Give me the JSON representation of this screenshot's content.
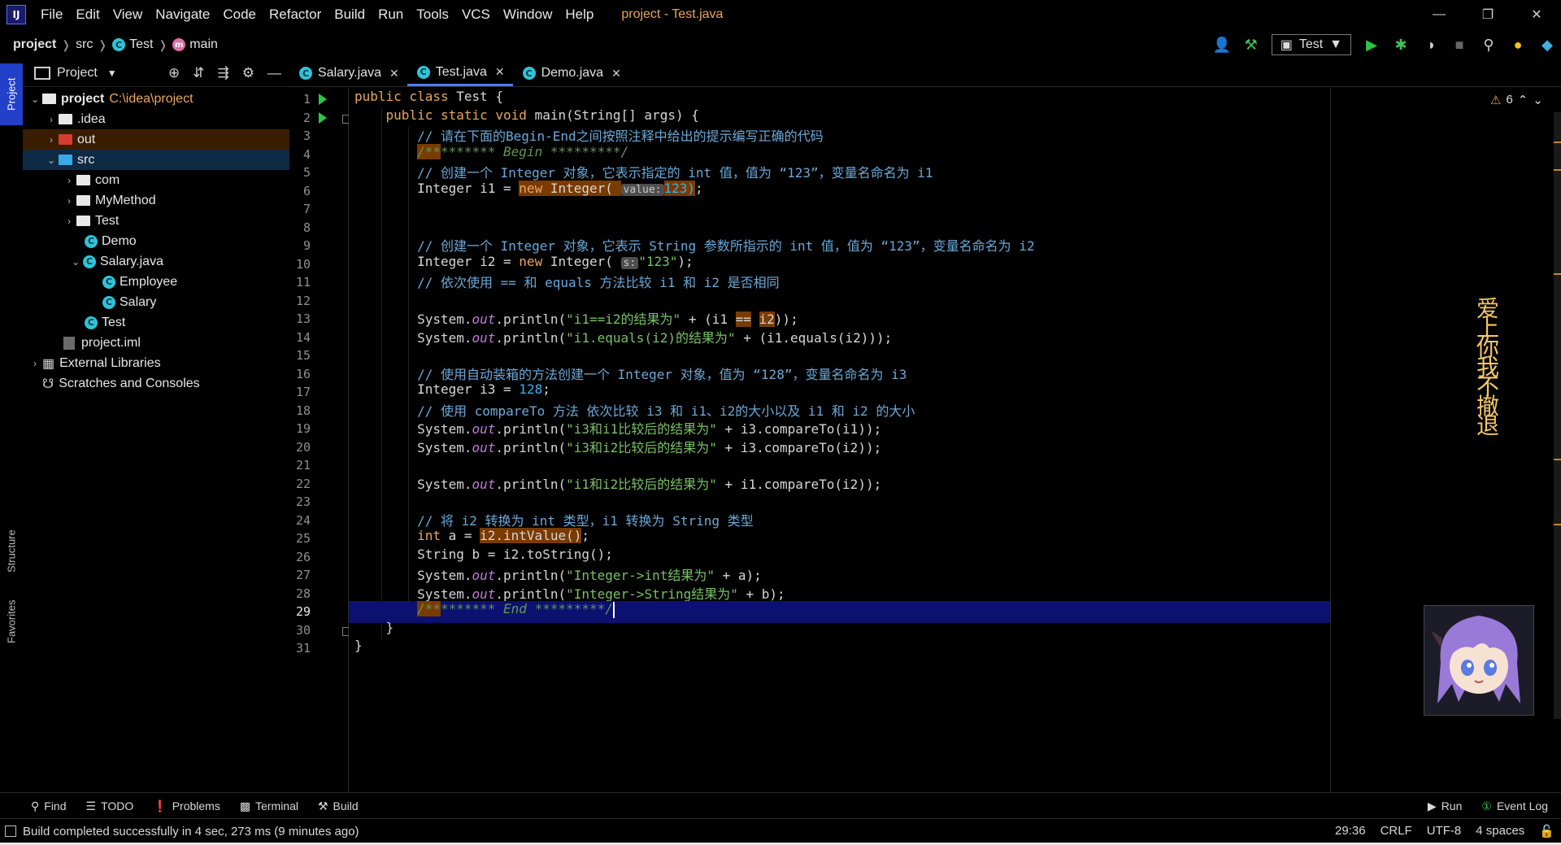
{
  "menubar": {
    "items": [
      "File",
      "Edit",
      "View",
      "Navigate",
      "Code",
      "Refactor",
      "Build",
      "Run",
      "Tools",
      "VCS",
      "Window",
      "Help"
    ],
    "title": "project - Test.java"
  },
  "breadcrumb": [
    "project",
    "src",
    "Test",
    "main"
  ],
  "run_config": "Test",
  "tool_windows": {
    "project": "Project",
    "structure": "Structure",
    "favorites": "Favorites"
  },
  "project_panel": {
    "title": "Project",
    "root": {
      "name": "project",
      "path": "C:\\idea\\project"
    },
    "items": [
      {
        "label": ".idea"
      },
      {
        "label": "out"
      },
      {
        "label": "src"
      },
      {
        "label": "com"
      },
      {
        "label": "MyMethod"
      },
      {
        "label": "Test"
      },
      {
        "label": "Demo"
      },
      {
        "label": "Salary.java"
      },
      {
        "label": "Employee"
      },
      {
        "label": "Salary"
      },
      {
        "label": "Test"
      },
      {
        "label": "project.iml"
      },
      {
        "label": "External Libraries"
      },
      {
        "label": "Scratches and Consoles"
      }
    ]
  },
  "tabs": [
    {
      "label": "Salary.java",
      "active": false
    },
    {
      "label": "Test.java",
      "active": true
    },
    {
      "label": "Demo.java",
      "active": false
    }
  ],
  "editor": {
    "warning_count": "6",
    "current_line": 29,
    "line_numbers": [
      "1",
      "2",
      "3",
      "4",
      "5",
      "6",
      "7",
      "8",
      "9",
      "10",
      "11",
      "12",
      "13",
      "14",
      "15",
      "16",
      "17",
      "18",
      "19",
      "20",
      "21",
      "22",
      "23",
      "24",
      "25",
      "26",
      "27",
      "28",
      "29",
      "30",
      "31"
    ],
    "code": [
      [
        [
          "kw",
          "public class "
        ],
        [
          "",
          "Test {"
        ]
      ],
      [
        [
          "",
          "    "
        ],
        [
          "kw",
          "public static void "
        ],
        [
          "",
          "main(String[] args) {"
        ]
      ],
      [
        [
          "",
          "        "
        ],
        [
          "cm",
          "// 请在下面的Begin-End之间按照注释中给出的提示编写正确的代码"
        ]
      ],
      [
        [
          "",
          "        "
        ],
        [
          "hl doc",
          "/**"
        ],
        [
          "doc",
          "******* Begin *********/"
        ]
      ],
      [
        [
          "",
          "        "
        ],
        [
          "cm",
          "// 创建一个 Integer 对象，它表示指定的 int 值，值为 “123”，变量名命名为 i1"
        ]
      ],
      [
        [
          "",
          "        Integer i1 = "
        ],
        [
          "hl kw",
          "new "
        ],
        [
          "hl",
          "Integer( "
        ],
        [
          "hint",
          "value:"
        ],
        [
          "hl nm2",
          "123)"
        ],
        [
          "",
          ";"
        ]
      ],
      [
        [
          "",
          ""
        ]
      ],
      [
        [
          "",
          ""
        ]
      ],
      [
        [
          "",
          "        "
        ],
        [
          "cm",
          "// 创建一个 Integer 对象，它表示 String 参数所指示的 int 值，值为 “123”，变量名命名为 i2"
        ]
      ],
      [
        [
          "",
          "        Integer i2 = "
        ],
        [
          "kw",
          "new "
        ],
        [
          "",
          "Integer( "
        ],
        [
          "hint",
          "s:"
        ],
        [
          "st",
          "\"123\""
        ],
        [
          "",
          ");"
        ]
      ],
      [
        [
          "",
          "        "
        ],
        [
          "cm",
          "// 依次使用 == 和 equals 方法比较 i1 和 i2 是否相同"
        ]
      ],
      [
        [
          "",
          ""
        ]
      ],
      [
        [
          "",
          "        System."
        ],
        [
          "fd",
          "out"
        ],
        [
          "",
          ".println("
        ],
        [
          "st",
          "\"i1==i2的结果为\""
        ],
        [
          "",
          " + (i1 "
        ],
        [
          "hl",
          "=="
        ],
        [
          "",
          " "
        ],
        [
          "hl",
          "i2"
        ],
        [
          "",
          "));"
        ]
      ],
      [
        [
          "",
          "        System."
        ],
        [
          "fd",
          "out"
        ],
        [
          "",
          ".println("
        ],
        [
          "st",
          "\"i1.equals(i2)的结果为\""
        ],
        [
          "",
          " + (i1.equals(i2)));"
        ]
      ],
      [
        [
          "",
          ""
        ]
      ],
      [
        [
          "",
          "        "
        ],
        [
          "cm",
          "// 使用自动装箱的方法创建一个 Integer 对象，值为 “128”，变量名命名为 i3"
        ]
      ],
      [
        [
          "",
          "        Integer i3 = "
        ],
        [
          "nm",
          "128"
        ],
        [
          "",
          ";"
        ]
      ],
      [
        [
          "",
          "        "
        ],
        [
          "cm",
          "// 使用 compareTo 方法 依次比较 i3 和 i1、i2的大小以及 i1 和 i2 的大小"
        ]
      ],
      [
        [
          "",
          "        System."
        ],
        [
          "fd",
          "out"
        ],
        [
          "",
          ".println("
        ],
        [
          "st",
          "\"i3和i1比较后的结果为\""
        ],
        [
          "",
          " + i3.compareTo(i1));"
        ]
      ],
      [
        [
          "",
          "        System."
        ],
        [
          "fd",
          "out"
        ],
        [
          "",
          ".println("
        ],
        [
          "st",
          "\"i3和i2比较后的结果为\""
        ],
        [
          "",
          " + i3.compareTo(i2));"
        ]
      ],
      [
        [
          "",
          ""
        ]
      ],
      [
        [
          "",
          "        System."
        ],
        [
          "fd",
          "out"
        ],
        [
          "",
          ".println("
        ],
        [
          "st",
          "\"i1和i2比较后的结果为\""
        ],
        [
          "",
          " + i1.compareTo(i2));"
        ]
      ],
      [
        [
          "",
          ""
        ]
      ],
      [
        [
          "",
          "        "
        ],
        [
          "cm",
          "// 将 i2 转换为 int 类型，i1 转换为 String 类型"
        ]
      ],
      [
        [
          "",
          "        "
        ],
        [
          "kw",
          "int "
        ],
        [
          "",
          "a = "
        ],
        [
          "hl",
          "i2.intValue()"
        ],
        [
          "",
          ";"
        ]
      ],
      [
        [
          "",
          "        String b = i2.toString();"
        ]
      ],
      [
        [
          "",
          "        System."
        ],
        [
          "fd",
          "out"
        ],
        [
          "",
          ".println("
        ],
        [
          "st",
          "\"Integer->int结果为\""
        ],
        [
          "",
          " + a);"
        ]
      ],
      [
        [
          "",
          "        System."
        ],
        [
          "fd",
          "out"
        ],
        [
          "",
          ".println("
        ],
        [
          "st",
          "\"Integer->String结果为\""
        ],
        [
          "",
          " + b);"
        ]
      ],
      [
        [
          "",
          "        "
        ],
        [
          "hl doc",
          "/**"
        ],
        [
          "doc",
          "******* End *********/"
        ]
      ],
      [
        [
          "",
          "    }"
        ]
      ],
      [
        [
          "",
          "}"
        ]
      ]
    ]
  },
  "side_text": "爱上你我不撤退",
  "bottom_tools": {
    "left": [
      "Find",
      "TODO",
      "Problems",
      "Terminal",
      "Build"
    ],
    "right": [
      "Run",
      "Event Log"
    ]
  },
  "status": {
    "message": "Build completed successfully in 4 sec, 273 ms (9 minutes ago)",
    "position": "29:36",
    "line_ending": "CRLF",
    "encoding": "UTF-8",
    "indent": "4 spaces"
  },
  "colors": {
    "keyword": "#e8a65c",
    "comment": "#6aa8d8",
    "string": "#79c066",
    "number": "#3ab0f0",
    "field": "#c07bd8",
    "highlight": "#7a3b00",
    "current_line": "#0c1070",
    "accent": "#4f7dff"
  }
}
